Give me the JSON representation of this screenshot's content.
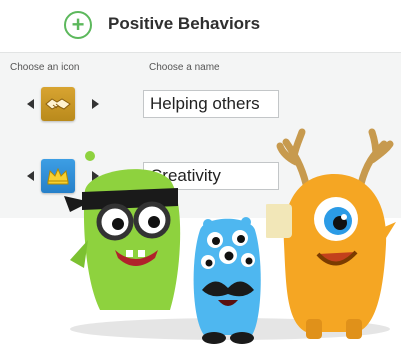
{
  "header": {
    "add_icon": "plus-circle-icon",
    "title": "Positive Behaviors"
  },
  "columns": {
    "icon": "Choose an icon",
    "name": "Choose a name"
  },
  "behaviors": [
    {
      "icon": "handshake-icon",
      "name": "Helping others",
      "badge_color": "#c99626"
    },
    {
      "icon": "crown-icon",
      "name": "Creativity",
      "badge_color": "#3490d6"
    }
  ],
  "colors": {
    "accent_green": "#5cb85c",
    "monster_green": "#8ed23e",
    "monster_blue": "#4eb7f0",
    "monster_orange": "#f5a623"
  }
}
